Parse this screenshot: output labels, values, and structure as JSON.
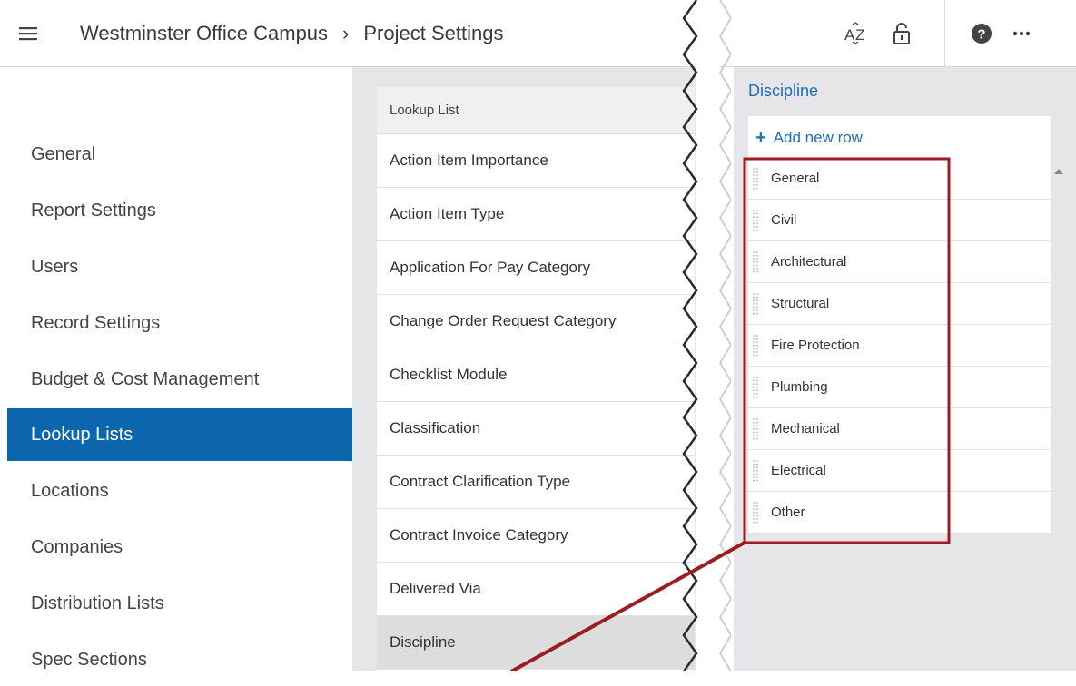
{
  "header": {
    "project": "Westminster Office Campus",
    "separator": "›",
    "page": "Project Settings",
    "tools": [
      "sort-az-icon",
      "unlock-icon",
      "help-icon",
      "more-icon"
    ]
  },
  "sidebar": {
    "items": [
      {
        "label": "General"
      },
      {
        "label": "Report Settings"
      },
      {
        "label": "Users"
      },
      {
        "label": "Record Settings"
      },
      {
        "label": "Budget & Cost Management"
      },
      {
        "label": "Lookup Lists",
        "active": true
      },
      {
        "label": "Locations"
      },
      {
        "label": "Companies"
      },
      {
        "label": "Distribution Lists"
      },
      {
        "label": "Spec Sections"
      }
    ]
  },
  "lookup": {
    "header": "Lookup List",
    "items": [
      {
        "label": "Action Item Importance"
      },
      {
        "label": "Action Item Type"
      },
      {
        "label": "Application For Pay Category"
      },
      {
        "label": "Change Order Request Category"
      },
      {
        "label": "Checklist Module"
      },
      {
        "label": "Classification"
      },
      {
        "label": "Contract Clarification Type"
      },
      {
        "label": "Contract Invoice Category"
      },
      {
        "label": "Delivered Via"
      },
      {
        "label": "Discipline",
        "selected": true
      }
    ]
  },
  "detail": {
    "title": "Discipline",
    "add_row": "Add new row",
    "rows": [
      "General",
      "Civil",
      "Architectural",
      "Structural",
      "Fire Protection",
      "Plumbing",
      "Mechanical",
      "Electrical",
      "Other"
    ]
  },
  "colors": {
    "accent": "#0b66ad",
    "link": "#1d6fb8",
    "highlight": "#9b1c23",
    "panel_bg": "#e6e6e9"
  }
}
